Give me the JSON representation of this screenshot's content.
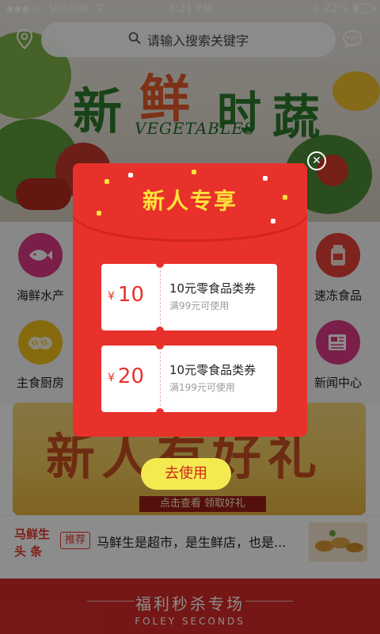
{
  "status_bar": {
    "carrier": "VIRGIN",
    "time": "4:21 PM",
    "battery": "22%",
    "battery_level": 0.22
  },
  "header": {
    "search_placeholder": "请输入搜索关键字",
    "banner_title": [
      "新",
      "鲜",
      "时",
      "蔬"
    ],
    "banner_subtitle": "VEGETABLES"
  },
  "categories": [
    {
      "label": "海鲜水产",
      "icon": "fish-icon",
      "color": "#de3a85"
    },
    {
      "label": "速冻食品",
      "icon": "frozen-food-icon",
      "color": "#e8413a"
    },
    {
      "label": "主食厨房",
      "icon": "bread-icon",
      "color": "#f2c21a"
    },
    {
      "label": "新闻中心",
      "icon": "news-icon",
      "color": "#de3a85"
    }
  ],
  "promo": {
    "title": "新人有好礼",
    "cta": "点击查看 领取好礼"
  },
  "news": {
    "logo_line1": "马鲜生",
    "logo_line2": "头 条",
    "tag": "推荐",
    "text": "马鲜生是超市，是生鲜店，也是..."
  },
  "bottom": {
    "title": "福利秒杀专场",
    "subtitle": "FOLEY SECONDS"
  },
  "modal": {
    "title": "新人专享",
    "coupons": [
      {
        "symbol": "¥",
        "amount": "10",
        "name": "10元零食品类券",
        "condition": "满99元可使用"
      },
      {
        "symbol": "¥",
        "amount": "20",
        "name": "10元零食品类券",
        "condition": "满199元可使用"
      }
    ],
    "button": "去使用",
    "colors": {
      "accent": "#e8312b",
      "title": "#ffe23a",
      "button": "#f4e94f"
    }
  }
}
